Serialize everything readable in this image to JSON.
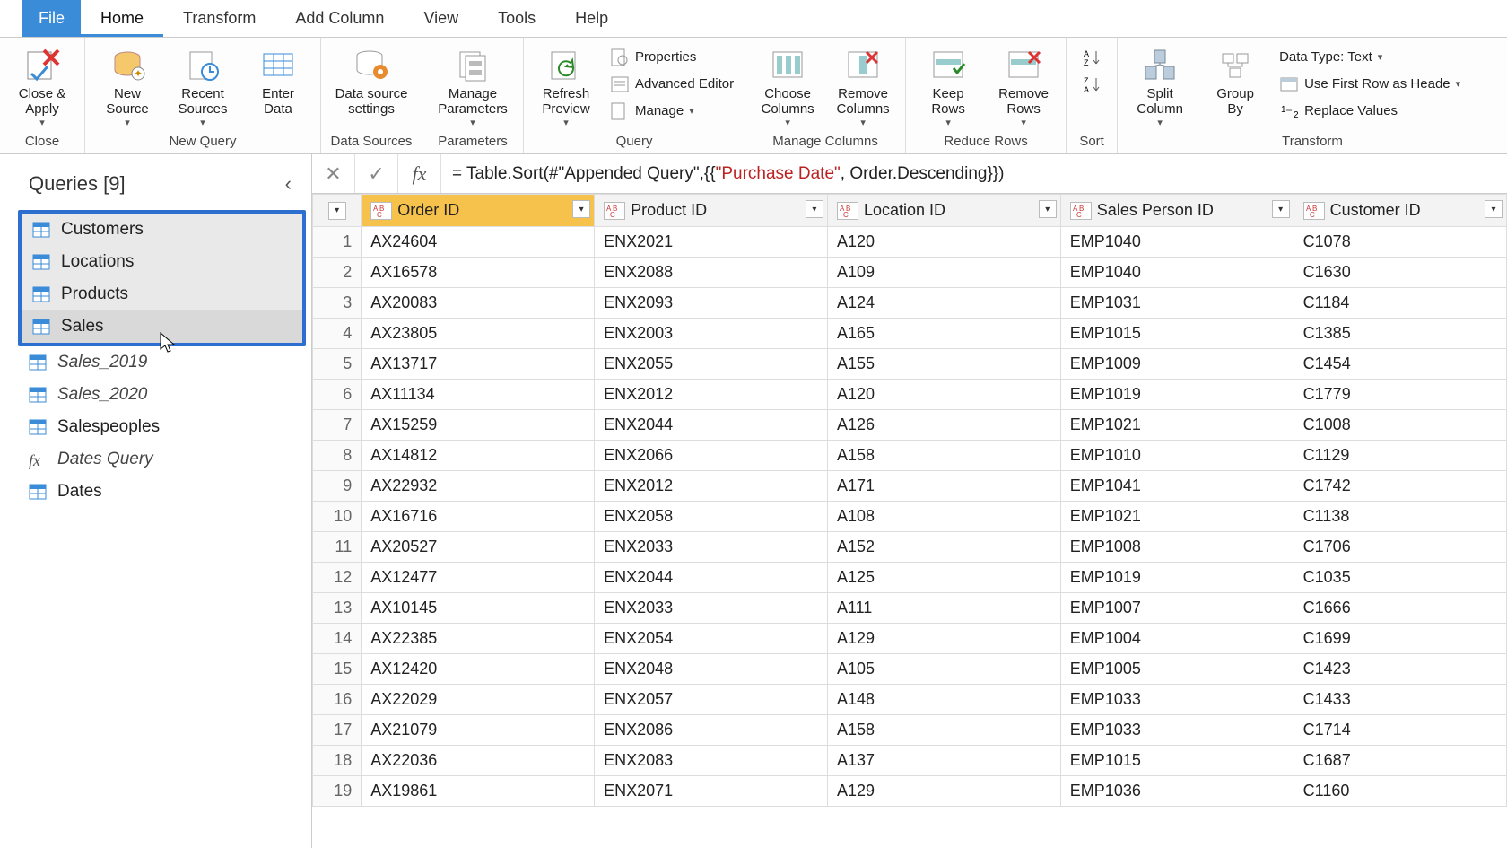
{
  "menu": {
    "file": "File",
    "tabs": [
      "Home",
      "Transform",
      "Add Column",
      "View",
      "Tools",
      "Help"
    ],
    "active": "Home"
  },
  "ribbon": {
    "close": {
      "close_apply": "Close &\nApply",
      "group": "Close"
    },
    "newquery": {
      "new_source": "New\nSource",
      "recent_sources": "Recent\nSources",
      "enter_data": "Enter\nData",
      "group": "New Query"
    },
    "datasources": {
      "settings": "Data source\nsettings",
      "group": "Data Sources"
    },
    "parameters": {
      "manage": "Manage\nParameters",
      "group": "Parameters"
    },
    "query": {
      "refresh": "Refresh\nPreview",
      "properties": "Properties",
      "advanced": "Advanced Editor",
      "manage": "Manage",
      "group": "Query"
    },
    "managecols": {
      "choose": "Choose\nColumns",
      "remove": "Remove\nColumns",
      "group": "Manage Columns"
    },
    "reducerows": {
      "keep": "Keep\nRows",
      "remove": "Remove\nRows",
      "group": "Reduce Rows"
    },
    "sort": {
      "group": "Sort"
    },
    "transform": {
      "split": "Split\nColumn",
      "groupby": "Group\nBy",
      "datatype": "Data Type: Text",
      "firstrow": "Use First Row as Heade",
      "replace": "Replace Values",
      "group": "Transform"
    }
  },
  "sidebar": {
    "title": "Queries [9]",
    "boxed": [
      {
        "label": "Customers",
        "type": "table"
      },
      {
        "label": "Locations",
        "type": "table"
      },
      {
        "label": "Products",
        "type": "table"
      },
      {
        "label": "Sales",
        "type": "table",
        "selected": true
      }
    ],
    "rest": [
      {
        "label": "Sales_2019",
        "type": "table",
        "italic": true
      },
      {
        "label": "Sales_2020",
        "type": "table",
        "italic": true
      },
      {
        "label": "Salespeoples",
        "type": "table"
      },
      {
        "label": "Dates Query",
        "type": "fx"
      },
      {
        "label": "Dates",
        "type": "table"
      }
    ]
  },
  "formula": {
    "prefix": "= Table.Sort(#\"Appended Query\",{{",
    "highlight": "\"Purchase Date\"",
    "suffix": ", Order.Descending}})"
  },
  "columns": [
    "Order ID",
    "Product ID",
    "Location ID",
    "Sales Person ID",
    "Customer ID"
  ],
  "selected_column_index": 0,
  "rows": [
    [
      "AX24604",
      "ENX2021",
      "A120",
      "EMP1040",
      "C1078"
    ],
    [
      "AX16578",
      "ENX2088",
      "A109",
      "EMP1040",
      "C1630"
    ],
    [
      "AX20083",
      "ENX2093",
      "A124",
      "EMP1031",
      "C1184"
    ],
    [
      "AX23805",
      "ENX2003",
      "A165",
      "EMP1015",
      "C1385"
    ],
    [
      "AX13717",
      "ENX2055",
      "A155",
      "EMP1009",
      "C1454"
    ],
    [
      "AX11134",
      "ENX2012",
      "A120",
      "EMP1019",
      "C1779"
    ],
    [
      "AX15259",
      "ENX2044",
      "A126",
      "EMP1021",
      "C1008"
    ],
    [
      "AX14812",
      "ENX2066",
      "A158",
      "EMP1010",
      "C1129"
    ],
    [
      "AX22932",
      "ENX2012",
      "A171",
      "EMP1041",
      "C1742"
    ],
    [
      "AX16716",
      "ENX2058",
      "A108",
      "EMP1021",
      "C1138"
    ],
    [
      "AX20527",
      "ENX2033",
      "A152",
      "EMP1008",
      "C1706"
    ],
    [
      "AX12477",
      "ENX2044",
      "A125",
      "EMP1019",
      "C1035"
    ],
    [
      "AX10145",
      "ENX2033",
      "A111",
      "EMP1007",
      "C1666"
    ],
    [
      "AX22385",
      "ENX2054",
      "A129",
      "EMP1004",
      "C1699"
    ],
    [
      "AX12420",
      "ENX2048",
      "A105",
      "EMP1005",
      "C1423"
    ],
    [
      "AX22029",
      "ENX2057",
      "A148",
      "EMP1033",
      "C1433"
    ],
    [
      "AX21079",
      "ENX2086",
      "A158",
      "EMP1033",
      "C1714"
    ],
    [
      "AX22036",
      "ENX2083",
      "A137",
      "EMP1015",
      "C1687"
    ],
    [
      "AX19861",
      "ENX2071",
      "A129",
      "EMP1036",
      "C1160"
    ]
  ]
}
